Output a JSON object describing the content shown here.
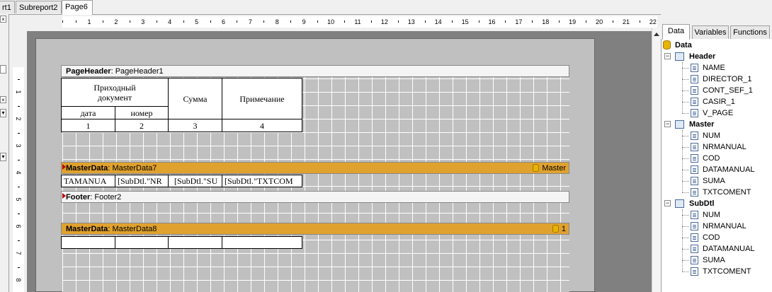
{
  "report_tabs": [
    "rt1",
    "Subreport2",
    "Page6"
  ],
  "ruler": {
    "h_labels": [
      "1",
      "2",
      "3",
      "4",
      "5",
      "6",
      "7",
      "8",
      "9",
      "10",
      "11",
      "12",
      "13",
      "14",
      "15",
      "16",
      "17",
      "18",
      "19",
      "20",
      "21",
      "22"
    ],
    "v_labels": [
      "1",
      "2",
      "3",
      "4",
      "5",
      "6",
      "7",
      "8"
    ]
  },
  "bands": {
    "page_header": {
      "type": "PageHeader",
      "name": "PageHeader1"
    },
    "master1": {
      "type": "MasterData",
      "name": "MasterData7",
      "dataset": "Master"
    },
    "footer": {
      "type": "Footer",
      "name": "Footer2"
    },
    "master2": {
      "type": "MasterData",
      "name": "MasterData8",
      "dataset": "1"
    }
  },
  "header_table": {
    "doc": "Приходный документ",
    "sum": "Сумма",
    "note": "Примечание",
    "date": "дата",
    "number": "номер",
    "n1": "1",
    "n2": "2",
    "n3": "3",
    "n4": "4"
  },
  "detail_row": [
    "TAMANUA",
    "[SubDtl.\"NR",
    "[SubDtl.\"SU",
    "[SubDtl.\"TXTCOM"
  ],
  "panel": {
    "tabs": [
      "Data",
      "Variables",
      "Functions"
    ],
    "root": "Data",
    "datasets": [
      {
        "name": "Header",
        "fields": [
          "NAME",
          "DIRECTOR_1",
          "CONT_SEF_1",
          "CASIR_1",
          "V_PAGE"
        ]
      },
      {
        "name": "Master",
        "fields": [
          "NUM",
          "NRMANUAL",
          "COD",
          "DATAMANUAL",
          "SUMA",
          "TXTCOMENT"
        ]
      },
      {
        "name": "SubDtl",
        "fields": [
          "NUM",
          "NRMANUAL",
          "COD",
          "DATAMANUAL",
          "SUMA",
          "TXTCOMENT"
        ]
      }
    ]
  },
  "colors": {
    "band_orange": "#e0a22e",
    "canvas_gray": "#808080",
    "page_gray": "#c0c0c0"
  }
}
